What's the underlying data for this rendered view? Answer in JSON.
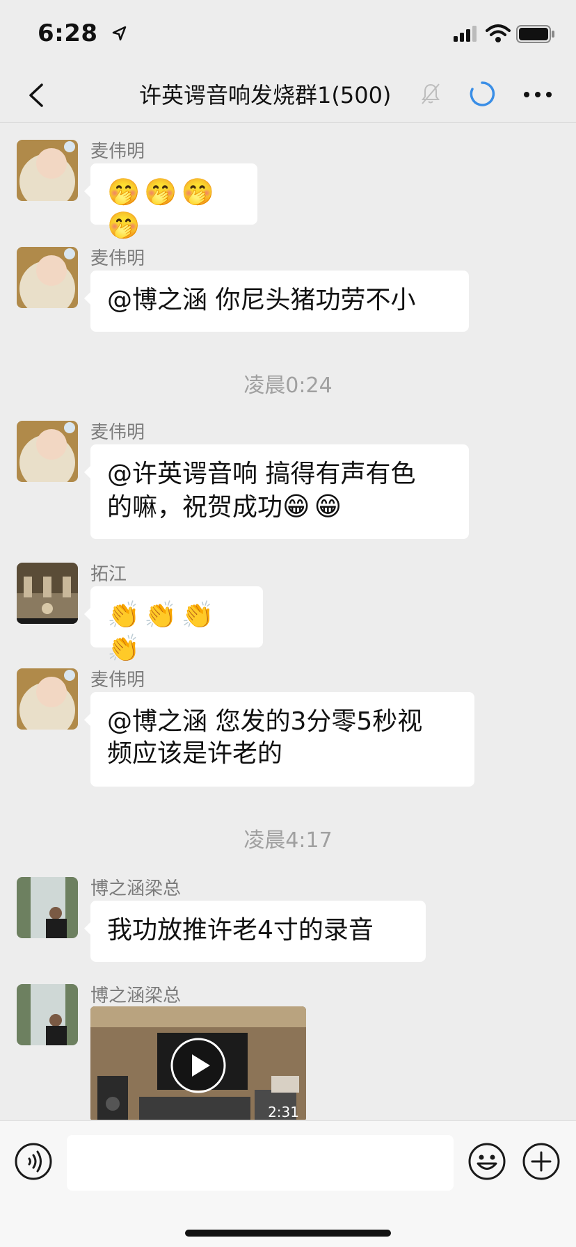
{
  "status_bar": {
    "time": "6:28"
  },
  "nav": {
    "title": "许英谔音响发烧群1(500)",
    "icons": [
      "chevron-left-icon",
      "bell-muted-icon",
      "loading-ring-icon",
      "more-dots-icon"
    ]
  },
  "messages": [
    {
      "sender": "麦伟明",
      "emojis": [
        "🤭",
        "🤭",
        "🤭",
        "🤭"
      ]
    },
    {
      "sender": "麦伟明",
      "text": "@博之涵 你尼头猪功劳不小"
    },
    {
      "time": "凌晨0:24"
    },
    {
      "sender": "麦伟明",
      "text_line1": "@许英谔音响 搞得有声有色",
      "text_line2": "的嘛，祝贺成功",
      "emojis": [
        "😁",
        "😁"
      ]
    },
    {
      "sender": "拓江",
      "emojis": [
        "👏",
        "👏",
        "👏",
        "👏"
      ]
    },
    {
      "sender": "麦伟明",
      "text_line1": "@博之涵 您发的3分零5秒视",
      "text_line2": "频应该是许老的"
    },
    {
      "time": "凌晨4:17"
    },
    {
      "sender": "博之涵梁总",
      "text": "我功放推许老4寸的录音"
    },
    {
      "sender": "博之涵梁总",
      "video_duration": "2:31"
    }
  ],
  "colors": {
    "accent_blue": "#3a8ee6",
    "background": "#ededed",
    "bubble": "#ffffff"
  }
}
